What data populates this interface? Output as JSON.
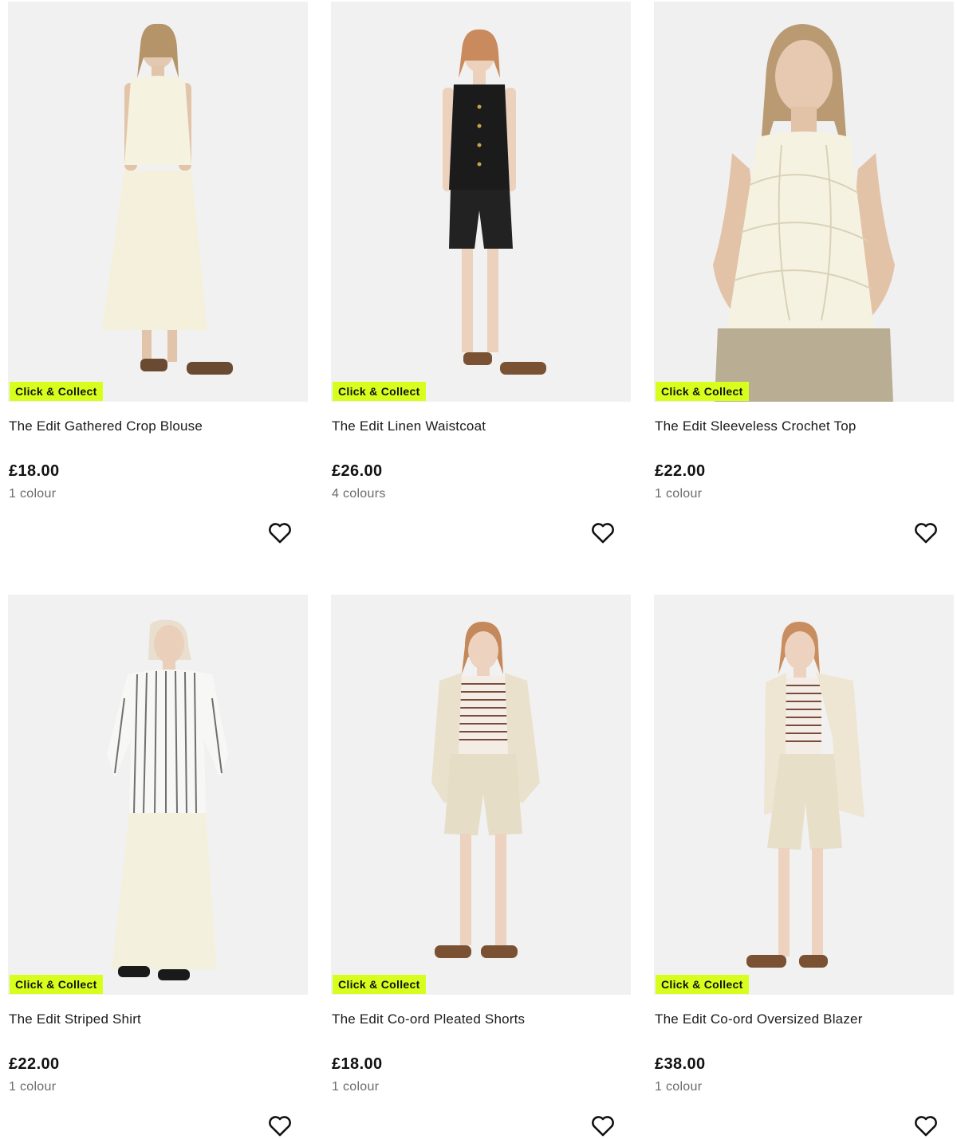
{
  "theme": {
    "badge_color": "#d7ff1e",
    "photo_background": "#f1f1f1",
    "price_color": "#111111",
    "muted_text": "#6b6b6b"
  },
  "products": [
    {
      "badge": "Click & Collect",
      "title": "The Edit Gathered Crop Blouse",
      "price": "£18.00",
      "colours": "1 colour",
      "wishlist_icon": "heart-outline-icon"
    },
    {
      "badge": "Click & Collect",
      "title": "The Edit Linen Waistcoat",
      "price": "£26.00",
      "colours": "4 colours",
      "wishlist_icon": "heart-outline-icon"
    },
    {
      "badge": "Click & Collect",
      "title": "The Edit Sleeveless Crochet Top",
      "price": "£22.00",
      "colours": "1 colour",
      "wishlist_icon": "heart-outline-icon"
    },
    {
      "badge": "Click & Collect",
      "title": "The Edit Striped Shirt",
      "price": "£22.00",
      "colours": "1 colour",
      "wishlist_icon": "heart-outline-icon"
    },
    {
      "badge": "Click & Collect",
      "title": "The Edit Co-ord Pleated Shorts",
      "price": "£18.00",
      "colours": "1 colour",
      "wishlist_icon": "heart-outline-icon"
    },
    {
      "badge": "Click & Collect",
      "title": "The Edit Co-ord Oversized Blazer",
      "price": "£38.00",
      "colours": "1 colour",
      "wishlist_icon": "heart-outline-icon"
    }
  ]
}
